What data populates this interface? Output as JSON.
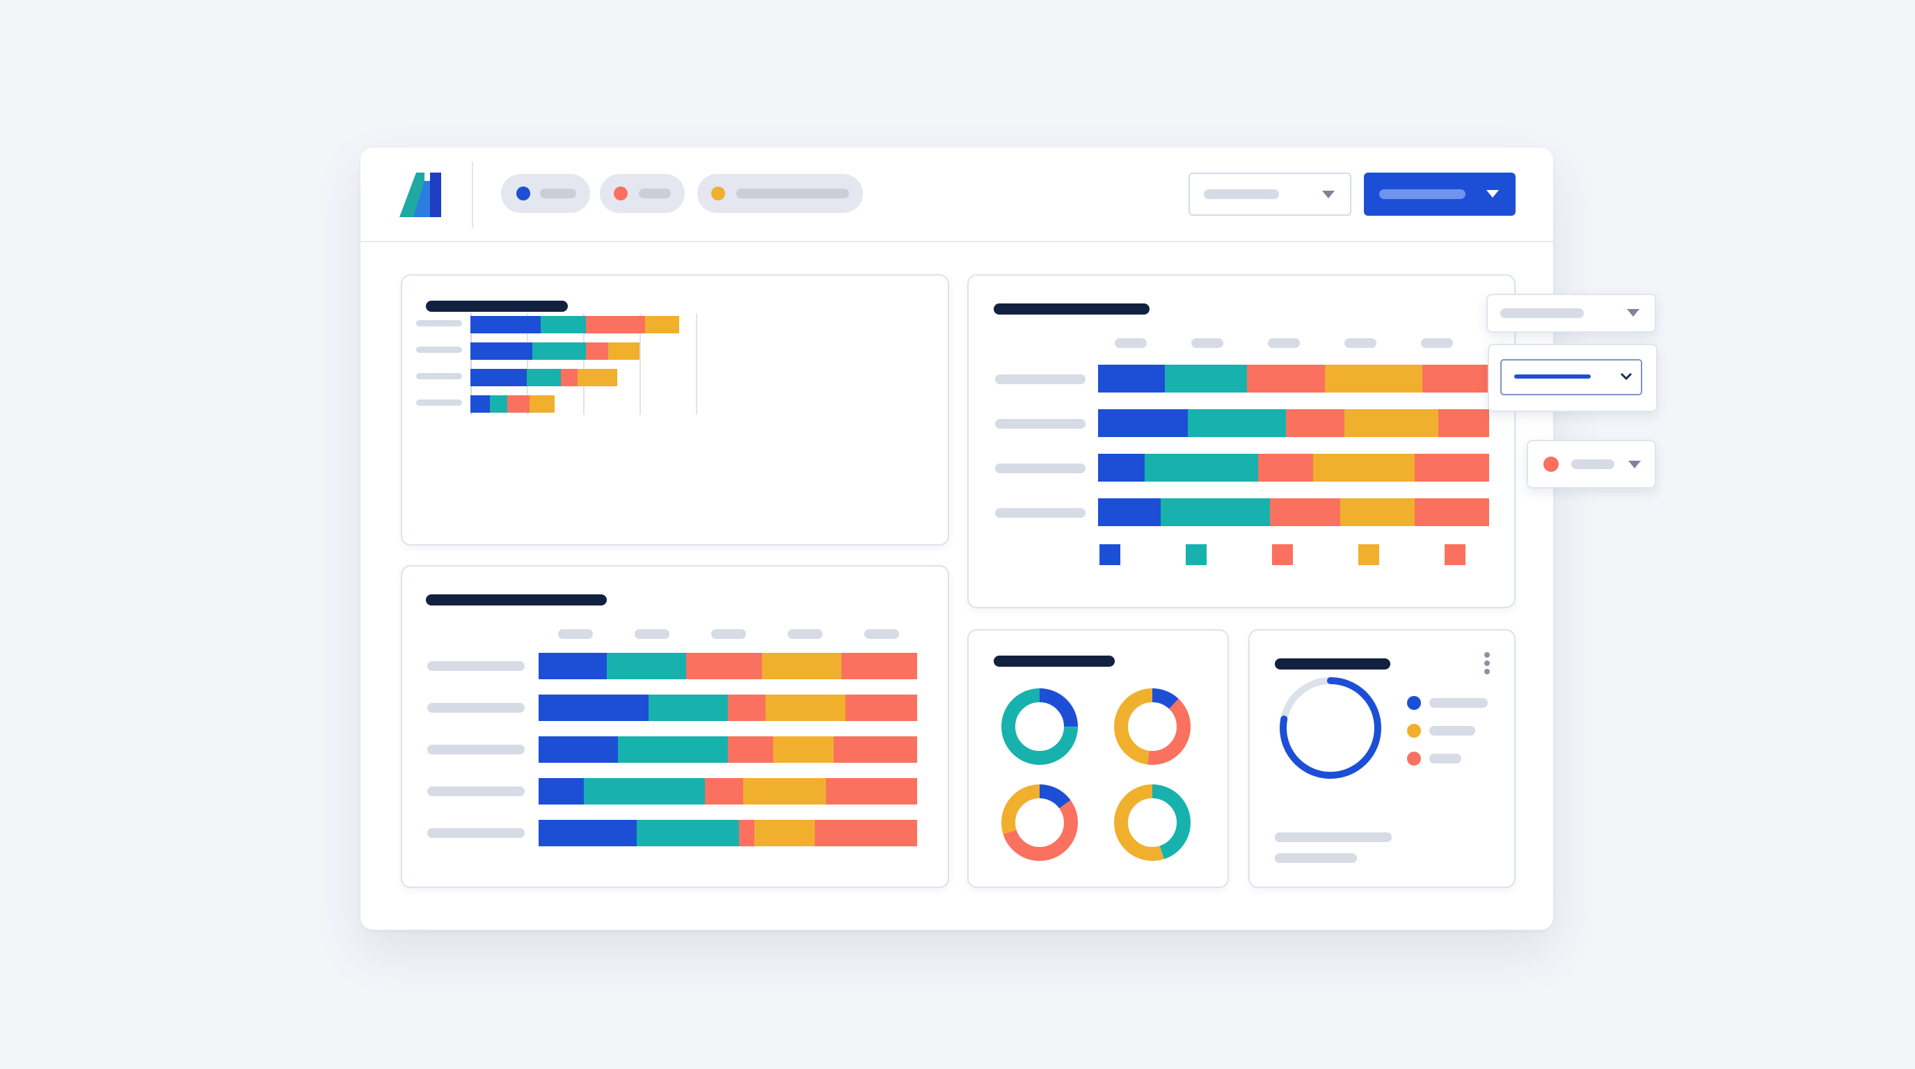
{
  "colors": {
    "blue": "#1d4fd6",
    "teal": "#17b2ad",
    "coral": "#fa715f",
    "amber": "#f0b02d",
    "navy": "#12213f",
    "placeholder": "#d6dbe6"
  },
  "header": {
    "logo": "app-logo",
    "filter_chips": [
      {
        "dot_color": "#1d4fd6"
      },
      {
        "dot_color": "#fa715f"
      },
      {
        "dot_color": "#f0b02d"
      }
    ],
    "select_icon": "chevron-down-icon",
    "primary_button_icon": "chevron-down-icon"
  },
  "chart_data": [
    {
      "type": "bar",
      "orientation": "horizontal",
      "stacked": true,
      "categories": [
        "",
        "",
        "",
        ""
      ],
      "series": [
        {
          "color": "#1d4fd6",
          "values": [
            25,
            22,
            20,
            7
          ]
        },
        {
          "color": "#17b2ad",
          "values": [
            16,
            19,
            12,
            6
          ]
        },
        {
          "color": "#fa715f",
          "values": [
            21,
            8,
            6,
            8
          ]
        },
        {
          "color": "#f0b02d",
          "values": [
            12,
            11,
            14,
            9
          ]
        }
      ],
      "xlim": [
        0,
        80
      ],
      "grid": true
    },
    {
      "type": "bar",
      "orientation": "horizontal",
      "stacked": true,
      "normalized": true,
      "categories": [
        "",
        "",
        "",
        ""
      ],
      "series": [
        {
          "color": "#1d4fd6",
          "values": [
            17,
            23,
            12,
            16
          ]
        },
        {
          "color": "#17b2ad",
          "values": [
            21,
            25,
            29,
            28
          ]
        },
        {
          "color": "#fa715f",
          "values": [
            20,
            15,
            14,
            18
          ]
        },
        {
          "color": "#f0b02d",
          "values": [
            25,
            24,
            26,
            19
          ]
        },
        {
          "color": "#fa715f",
          "values": [
            17,
            13,
            19,
            19
          ]
        }
      ],
      "legend": "bottom"
    },
    {
      "type": "bar",
      "orientation": "horizontal",
      "stacked": true,
      "normalized": true,
      "categories": [
        "",
        "",
        "",
        "",
        ""
      ],
      "series": [
        {
          "color": "#1d4fd6",
          "values": [
            18,
            29,
            21,
            12,
            26
          ]
        },
        {
          "color": "#17b2ad",
          "values": [
            21,
            21,
            29,
            32,
            27
          ]
        },
        {
          "color": "#fa715f",
          "values": [
            20,
            10,
            12,
            10,
            4
          ]
        },
        {
          "color": "#f0b02d",
          "values": [
            21,
            21,
            16,
            22,
            16
          ]
        },
        {
          "color": "#fa715f",
          "values": [
            20,
            19,
            22,
            24,
            27
          ]
        }
      ],
      "legend": "top"
    },
    {
      "type": "pie",
      "variant": "donut-grid",
      "donuts": [
        {
          "slices": [
            {
              "color": "#1d4fd6",
              "value": 25
            },
            {
              "color": "#17b2ad",
              "value": 75
            }
          ]
        },
        {
          "slices": [
            {
              "color": "#1d4fd6",
              "value": 12
            },
            {
              "color": "#fa715f",
              "value": 40
            },
            {
              "color": "#f0b02d",
              "value": 48
            }
          ]
        },
        {
          "slices": [
            {
              "color": "#1d4fd6",
              "value": 15
            },
            {
              "color": "#fa715f",
              "value": 55
            },
            {
              "color": "#f0b02d",
              "value": 30
            }
          ]
        },
        {
          "slices": [
            {
              "color": "#17b2ad",
              "value": 45
            },
            {
              "color": "#f0b02d",
              "value": 55
            }
          ]
        }
      ]
    },
    {
      "type": "pie",
      "variant": "progress-ring",
      "value": 0.78,
      "color": "#1d4fd6",
      "track_color": "#dde1ea",
      "legend_colors": [
        "#1d4fd6",
        "#f0b02d",
        "#fa715f"
      ]
    }
  ],
  "floating_controls": {
    "select_icon": "chevron-down-icon",
    "active_select_icon": "chevron-down-icon",
    "status_dot_color": "#fa715f"
  },
  "card_menu_icon": "kebab-menu-icon"
}
